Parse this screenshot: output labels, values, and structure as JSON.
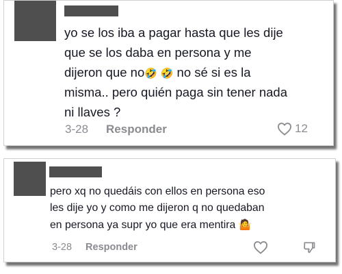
{
  "comments": [
    {
      "text_before_emoji": "yo se los iba a pagar hasta que les dije\nque se los daba en persona y me\ndijeron que no",
      "emojis": "🤣 🤣",
      "text_after_emoji": "  no sé si es la\nmisma.. pero quién paga sin tener nada\nni llaves ?",
      "date": "3-28",
      "reply_label": "Responder",
      "like_count": "12"
    },
    {
      "text_before_emoji": "pero xq no quedáis con ellos en persona eso\nles dije yo y como me dijeron q no quedaban\nen persona ya supr yo que era mentira ",
      "emojis": "🤷",
      "text_after_emoji": "",
      "date": "3-28",
      "reply_label": "Responder"
    }
  ],
  "icons": {
    "like": "heart-outline-icon",
    "dislike": "thumbs-down-outline-icon"
  },
  "colors": {
    "text": "#161823",
    "meta": "#8a8b91",
    "redaction": "#4f4f4f"
  }
}
